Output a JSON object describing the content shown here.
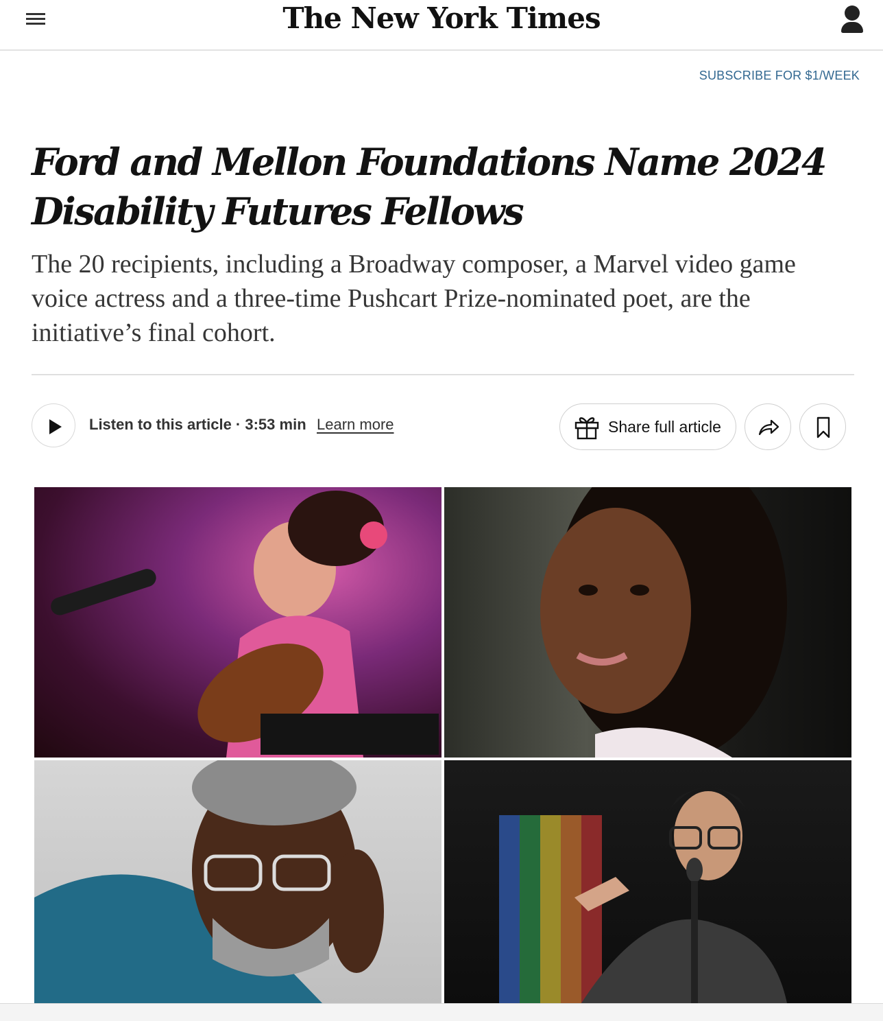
{
  "header": {
    "logo_text": "The New York Times",
    "subscribe_label": "SUBSCRIBE FOR $1/WEEK"
  },
  "article": {
    "headline": "Ford and Mellon Foundations Name 2024 Disability Futures Fellows",
    "summary": "The 20 recipients, including a Broadway composer, a Marvel video game voice actress and a three-time Pushcart Prize-nominated poet, are the initiative’s final cohort."
  },
  "audio": {
    "listen_label": "Listen to this article · 3:53 min",
    "learn_more": "Learn more"
  },
  "actions": {
    "share_label": "Share full article"
  },
  "colors": {
    "link_blue": "#326891",
    "text": "#121212",
    "summary_text": "#363636"
  },
  "icons": [
    "menu-icon",
    "account-icon",
    "play-icon",
    "gift-icon",
    "share-forward-icon",
    "bookmark-icon"
  ]
}
